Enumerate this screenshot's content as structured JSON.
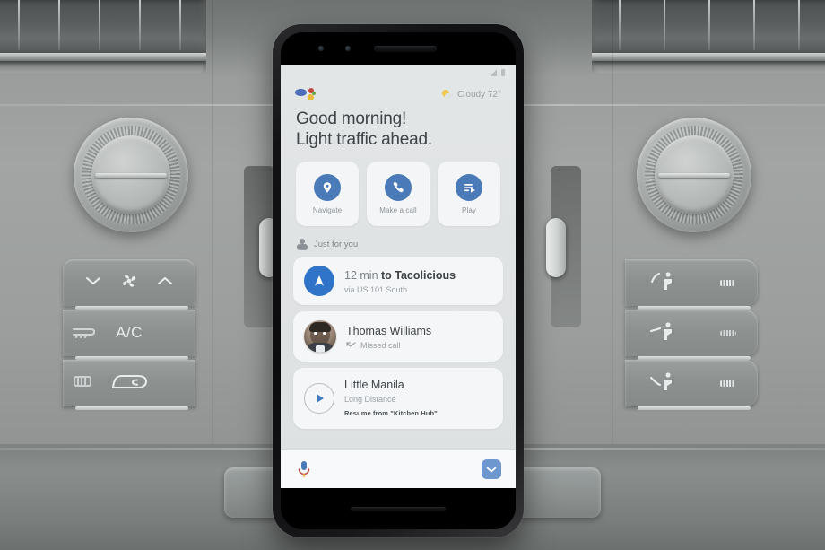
{
  "scene": {
    "context": "car-dashboard-with-mounted-phone"
  },
  "car": {
    "climate": {
      "fan_down_icon": "chevron-down-icon",
      "fan_icon": "fan-icon",
      "fan_up_icon": "chevron-up-icon",
      "ac_label": "A/C",
      "recirculate_icon": "recirculate-air-icon",
      "defrost_icon": "defrost-icon",
      "airflow_face_icon": "airflow-face-icon",
      "airflow_body_icon": "airflow-body-icon",
      "airflow_feet_icon": "airflow-feet-icon"
    },
    "knob_left_name": "temperature-knob-left",
    "knob_right_name": "temperature-knob-right"
  },
  "phone": {
    "status_bar": {
      "time": "",
      "signal_icon": "signal-bars-icon",
      "battery_icon": "battery-icon"
    },
    "header": {
      "assistant_logo": "google-assistant-logo",
      "weather_icon": "sun-cloud-icon",
      "weather_text": "Cloudy 72°"
    },
    "greeting": {
      "line1": "Good morning!",
      "line2": "Light traffic ahead."
    },
    "quick_actions": [
      {
        "label": "Navigate",
        "icon": "location-pin-icon"
      },
      {
        "label": "Make a call",
        "icon": "phone-icon"
      },
      {
        "label": "Play",
        "icon": "playlist-play-icon"
      }
    ],
    "just_for_you": {
      "icon": "person-icon",
      "label": "Just for you"
    },
    "feed": [
      {
        "type": "navigation",
        "icon": "navigation-arrow-icon",
        "title_lead": "12 min",
        "title_rest": " to Tacolicious",
        "subtitle": "via US 101 South"
      },
      {
        "type": "call",
        "icon": "avatar",
        "title": "Thomas Williams",
        "status_icon": "missed-call-icon",
        "subtitle": "Missed call"
      },
      {
        "type": "media",
        "icon": "play-circle-icon",
        "title": "Little Manila",
        "subtitle": "Long Distance",
        "resume": "Resume from \"Kitchen Hub\""
      }
    ],
    "bottom_bar": {
      "mic_icon": "microphone-icon",
      "collapse_icon": "chevron-down-icon"
    }
  },
  "colors": {
    "accent_blue": "#4a7ab8",
    "nav_blue": "#2f74c9",
    "chevron_blue": "#6f97cf",
    "text_dark": "#3d4246",
    "text_muted": "#9ba1a6",
    "screen_bg": "#e0e3e4",
    "card_bg": "#f4f6f7"
  }
}
